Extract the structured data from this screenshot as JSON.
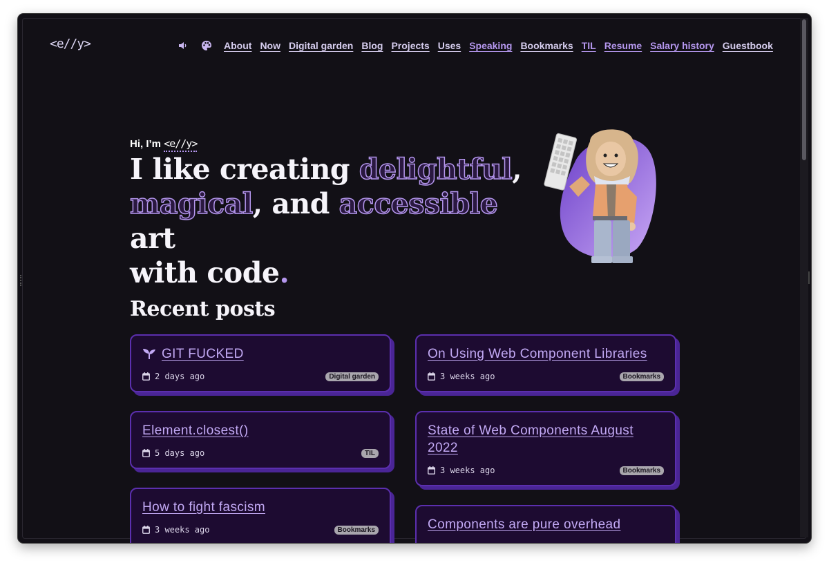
{
  "header": {
    "logo": "<e//y>",
    "nav": [
      {
        "label": "About",
        "tone": "c1"
      },
      {
        "label": "Now",
        "tone": "c1"
      },
      {
        "label": "Digital garden",
        "tone": "c1"
      },
      {
        "label": "Blog",
        "tone": "c1"
      },
      {
        "label": "Projects",
        "tone": "c1"
      },
      {
        "label": "Uses",
        "tone": "c1"
      },
      {
        "label": "Speaking",
        "tone": "c2"
      },
      {
        "label": "Bookmarks",
        "tone": "c1"
      },
      {
        "label": "TIL",
        "tone": "c2"
      },
      {
        "label": "Resume",
        "tone": "c2"
      },
      {
        "label": "Salary history",
        "tone": "c2"
      },
      {
        "label": "Guestbook",
        "tone": "c1"
      }
    ],
    "icons": [
      "speaker-icon",
      "palette-icon"
    ]
  },
  "hero": {
    "intro_prefix": "Hi, I’m",
    "intro_logo": "<e//y>",
    "line1_a": "I like creating ",
    "word_delightful": "delightful",
    "comma1": ",",
    "word_magical": "magical",
    "line2_mid": ", and ",
    "word_accessible": "accessible",
    "line2_end": " art",
    "line3": "with code",
    "dot": "."
  },
  "posts": {
    "title": "Recent posts",
    "items": [
      {
        "title": "GIT FUCKED",
        "date": "2 days ago",
        "badge": "Digital garden",
        "icon": "sprout-icon"
      },
      {
        "title": "On Using Web Component Libraries",
        "date": "3 weeks ago",
        "badge": "Bookmarks"
      },
      {
        "title": "Element.closest()",
        "date": "5 days ago",
        "badge": "TIL"
      },
      {
        "title": "State of Web Components August 2022",
        "date": "3 weeks ago",
        "badge": "Bookmarks"
      },
      {
        "title": "How to fight fascism",
        "date": "3 weeks ago",
        "badge": "Bookmarks"
      },
      {
        "title": "Components are pure overhead",
        "date": "",
        "badge": ""
      }
    ]
  },
  "colors": {
    "background": "#121016",
    "accent": "#b597ee",
    "card_bg": "#1d0b31",
    "card_border": "#5b2fae"
  }
}
